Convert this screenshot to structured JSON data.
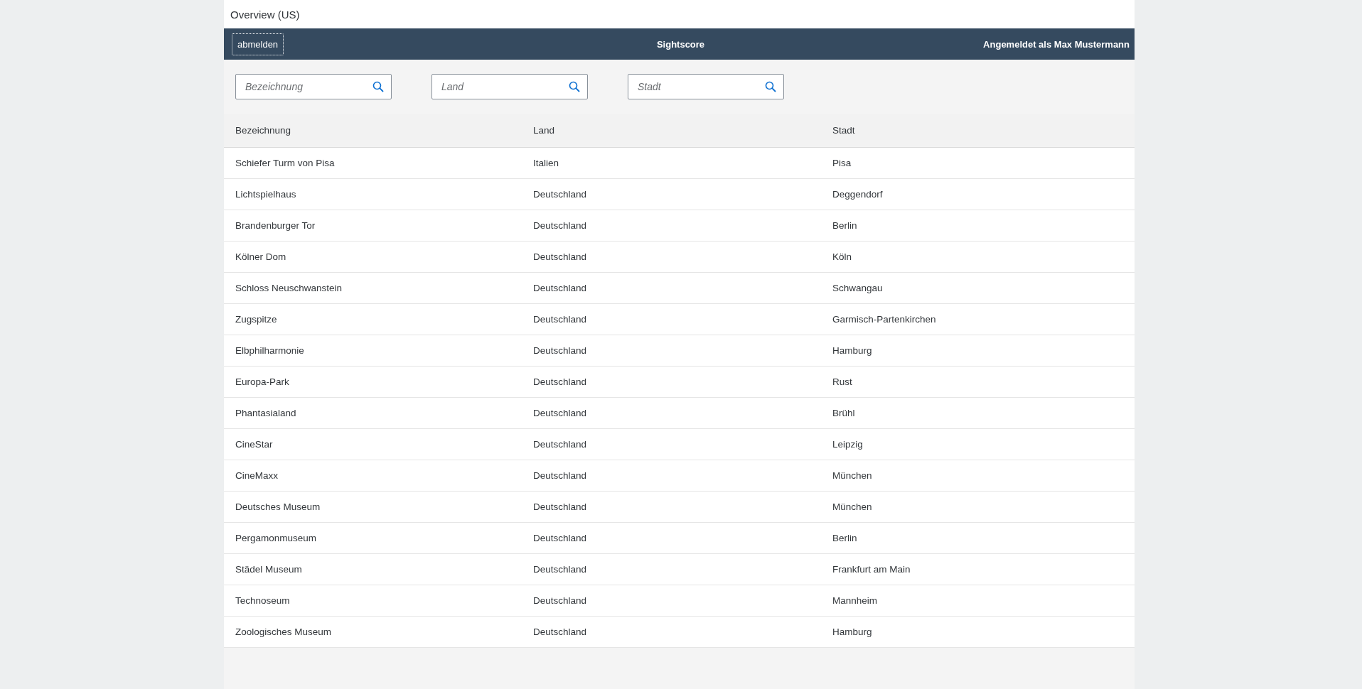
{
  "window": {
    "title": "Overview (US)"
  },
  "header": {
    "logout_button": "abmelden",
    "app_title": "Sightscore",
    "user_text": "Angemeldet als Max Mustermann"
  },
  "filters": [
    {
      "placeholder": "Bezeichnung"
    },
    {
      "placeholder": "Land"
    },
    {
      "placeholder": "Stadt"
    }
  ],
  "table": {
    "columns": [
      "Bezeichnung",
      "Land",
      "Stadt"
    ],
    "rows": [
      [
        "Schiefer Turm von Pisa",
        "Italien",
        "Pisa"
      ],
      [
        "Lichtspielhaus",
        "Deutschland",
        "Deggendorf"
      ],
      [
        "Brandenburger Tor",
        "Deutschland",
        "Berlin"
      ],
      [
        "Kölner Dom",
        "Deutschland",
        "Köln"
      ],
      [
        "Schloss Neuschwanstein",
        "Deutschland",
        "Schwangau"
      ],
      [
        "Zugspitze",
        "Deutschland",
        "Garmisch-Partenkirchen"
      ],
      [
        "Elbphilharmonie",
        "Deutschland",
        "Hamburg"
      ],
      [
        "Europa-Park",
        "Deutschland",
        "Rust"
      ],
      [
        "Phantasialand",
        "Deutschland",
        "Brühl"
      ],
      [
        "CineStar",
        "Deutschland",
        "Leipzig"
      ],
      [
        "CineMaxx",
        "Deutschland",
        "München"
      ],
      [
        "Deutsches Museum",
        "Deutschland",
        "München"
      ],
      [
        "Pergamonmuseum",
        "Deutschland",
        "Berlin"
      ],
      [
        "Städel Museum",
        "Deutschland",
        "Frankfurt am Main"
      ],
      [
        "Technoseum",
        "Deutschland",
        "Mannheim"
      ],
      [
        "Zoologisches Museum",
        "Deutschland",
        "Hamburg"
      ]
    ]
  }
}
